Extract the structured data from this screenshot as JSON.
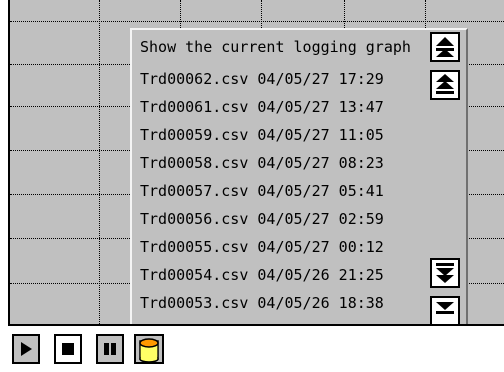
{
  "file_list": {
    "header": "Show the current logging graph",
    "files": [
      "Trd00062.csv 04/05/27 17:29",
      "Trd00061.csv 04/05/27 13:47",
      "Trd00059.csv 04/05/27 11:05",
      "Trd00058.csv 04/05/27 08:23",
      "Trd00057.csv 04/05/27 05:41",
      "Trd00056.csv 04/05/27 02:59",
      "Trd00055.csv 04/05/27 00:12",
      "Trd00054.csv 04/05/26 21:25",
      "Trd00053.csv 04/05/26 18:38"
    ]
  },
  "scroll_buttons": [
    "double-up-arrow-icon",
    "triple-up-arrow-icon",
    "triple-down-arrow-icon",
    "double-down-arrow-icon"
  ],
  "toolbar": {
    "buttons": [
      "play-icon",
      "stop-icon",
      "pause-icon",
      "database-icon"
    ]
  },
  "colors": {
    "panel": "#c0c0c0",
    "db_top": "#ff9900",
    "db_body": "#ffff66"
  }
}
